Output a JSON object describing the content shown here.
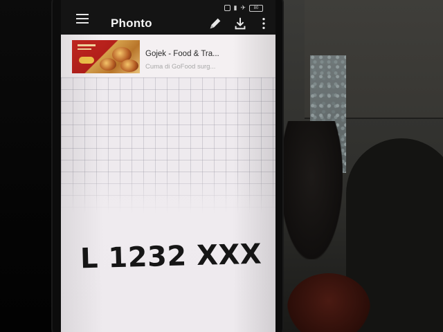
{
  "app": {
    "title": "Phonto"
  },
  "status_bar": {
    "battery_label": "80"
  },
  "toolbar": {
    "icons": [
      "menu-icon",
      "pencil-icon",
      "download-icon",
      "more-vert-icon"
    ]
  },
  "ad": {
    "title": "Gojek - Food & Tra...",
    "subtitle": "Cuma di GoFood surg..."
  },
  "canvas": {
    "text": "L 1232 XXX"
  },
  "colors": {
    "app_bar": "#141414",
    "canvas_bg": "#eeeaee",
    "text_black": "#161616",
    "ad_red": "#c92a22"
  }
}
